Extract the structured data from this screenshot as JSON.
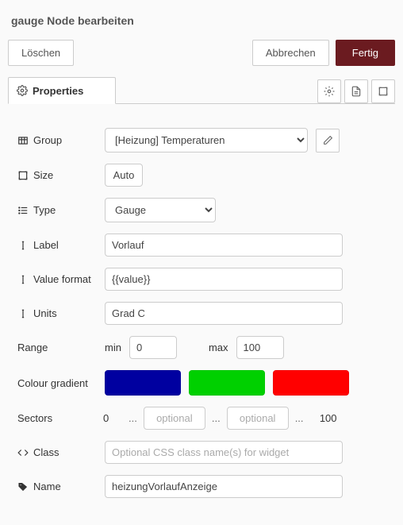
{
  "title": "gauge Node bearbeiten",
  "buttons": {
    "delete": "Löschen",
    "cancel": "Abbrechen",
    "done": "Fertig"
  },
  "tab": {
    "properties": "Properties"
  },
  "labels": {
    "group": "Group",
    "size": "Size",
    "type": "Type",
    "label": "Label",
    "value_format": "Value format",
    "units": "Units",
    "range": "Range",
    "range_min": "min",
    "range_max": "max",
    "colours": "Colour gradient",
    "sectors": "Sectors",
    "class": "Class",
    "name": "Name",
    "sectors_sep": "..."
  },
  "values": {
    "group": "[Heizung] Temperaturen",
    "size": "Auto",
    "type": "Gauge",
    "label": "Vorlauf",
    "value_format": "{{value}}",
    "units": "Grad C",
    "range_min": "0",
    "range_max": "100",
    "sector_low": "0",
    "sector_high": "100",
    "sector_opt": "",
    "class": "",
    "name": "heizungVorlaufAnzeige"
  },
  "placeholders": {
    "optional": "optional",
    "class": "Optional CSS class name(s) for widget"
  },
  "colors": {
    "grad1": "#0000a0",
    "grad2": "#00d000",
    "grad3": "#ff0000"
  }
}
